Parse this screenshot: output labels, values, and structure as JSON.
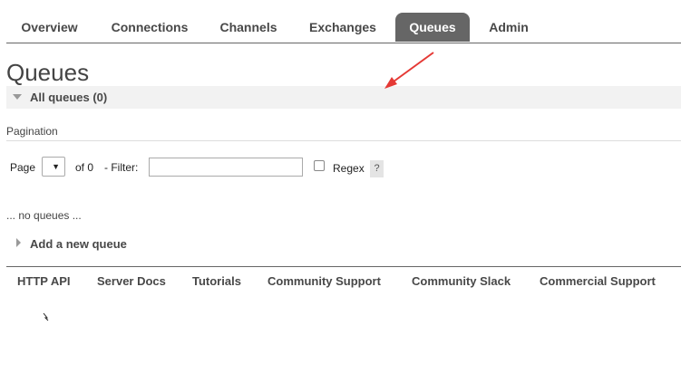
{
  "nav": {
    "tabs": [
      {
        "label": "Overview"
      },
      {
        "label": "Connections"
      },
      {
        "label": "Channels"
      },
      {
        "label": "Exchanges"
      },
      {
        "label": "Queues",
        "active": true
      },
      {
        "label": "Admin"
      }
    ]
  },
  "page": {
    "title": "Queues",
    "section_title": "All queues (0)"
  },
  "pagination": {
    "label": "Pagination",
    "page_label": "Page",
    "page_select_icon": "▼",
    "of_label": "of 0",
    "filter_label": "- Filter:",
    "filter_value": "",
    "regex_label": "Regex",
    "help_label": "?"
  },
  "content": {
    "empty_message": "... no queues ...",
    "add_queue_label": "Add a new queue"
  },
  "footer": {
    "links": [
      "HTTP API",
      "Server Docs",
      "Tutorials",
      "Community Support",
      "Community Slack",
      "Commercial Support"
    ]
  },
  "colors": {
    "active_tab_bg": "#666666",
    "annotation_arrow": "#e53935"
  }
}
